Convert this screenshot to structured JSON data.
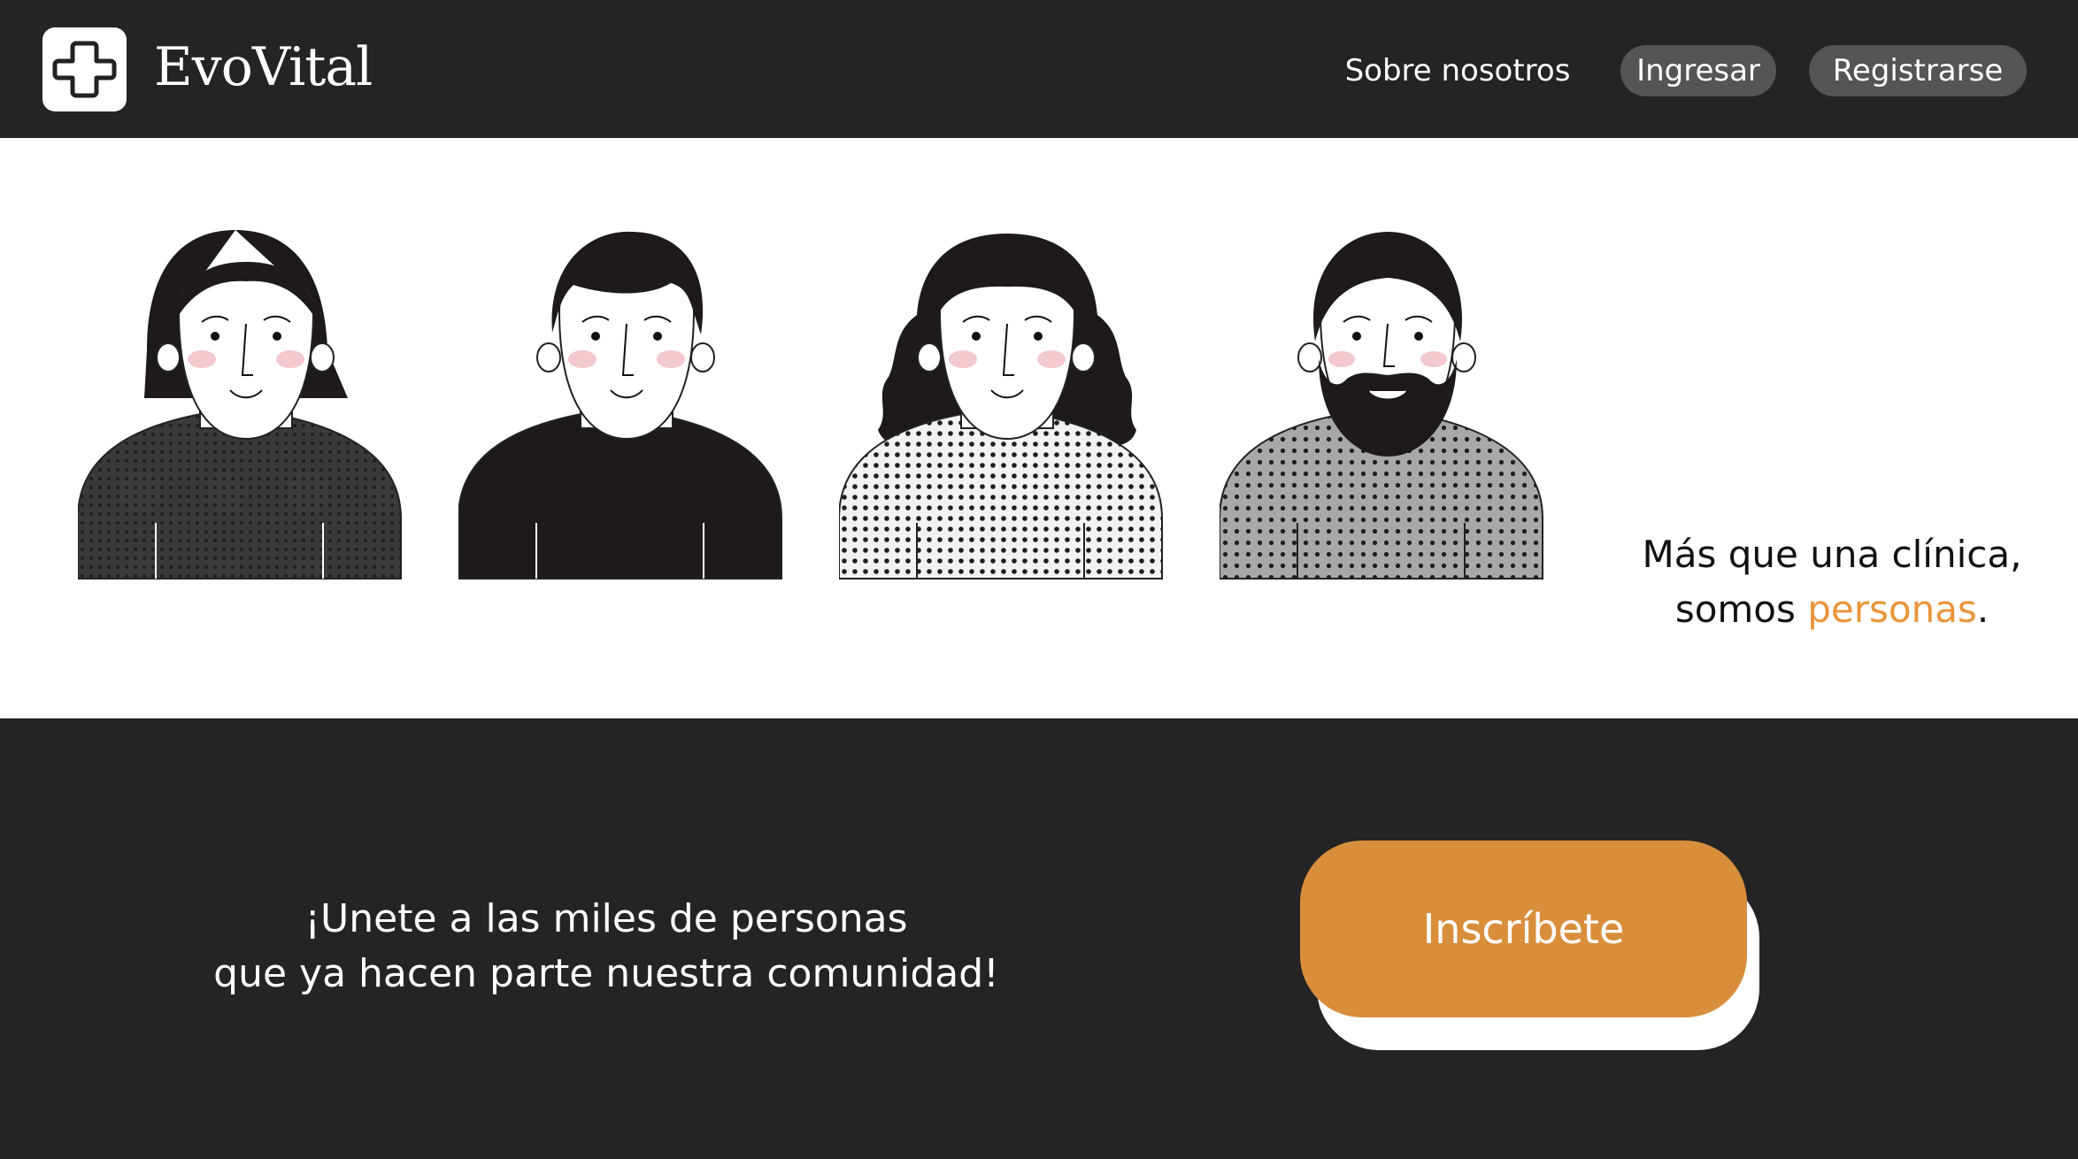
{
  "header": {
    "brand": "EvoVital",
    "nav_about": "Sobre nosotros",
    "login_label": "Ingresar",
    "signup_label": "Registrarse"
  },
  "hero": {
    "line1": "Más que una clínica,",
    "line2_prefix": "somos ",
    "line2_accent": "personas",
    "line2_suffix": "."
  },
  "cta": {
    "line1": "¡Unete a las miles de personas",
    "line2": "que ya hacen parte nuestra comunidad!",
    "button_label": "Inscríbete"
  },
  "colors": {
    "dark": "#242424",
    "accent": "#d98e3c",
    "accent_text": "#e9953a"
  },
  "icons": {
    "logo": "medical-cross-icon"
  }
}
